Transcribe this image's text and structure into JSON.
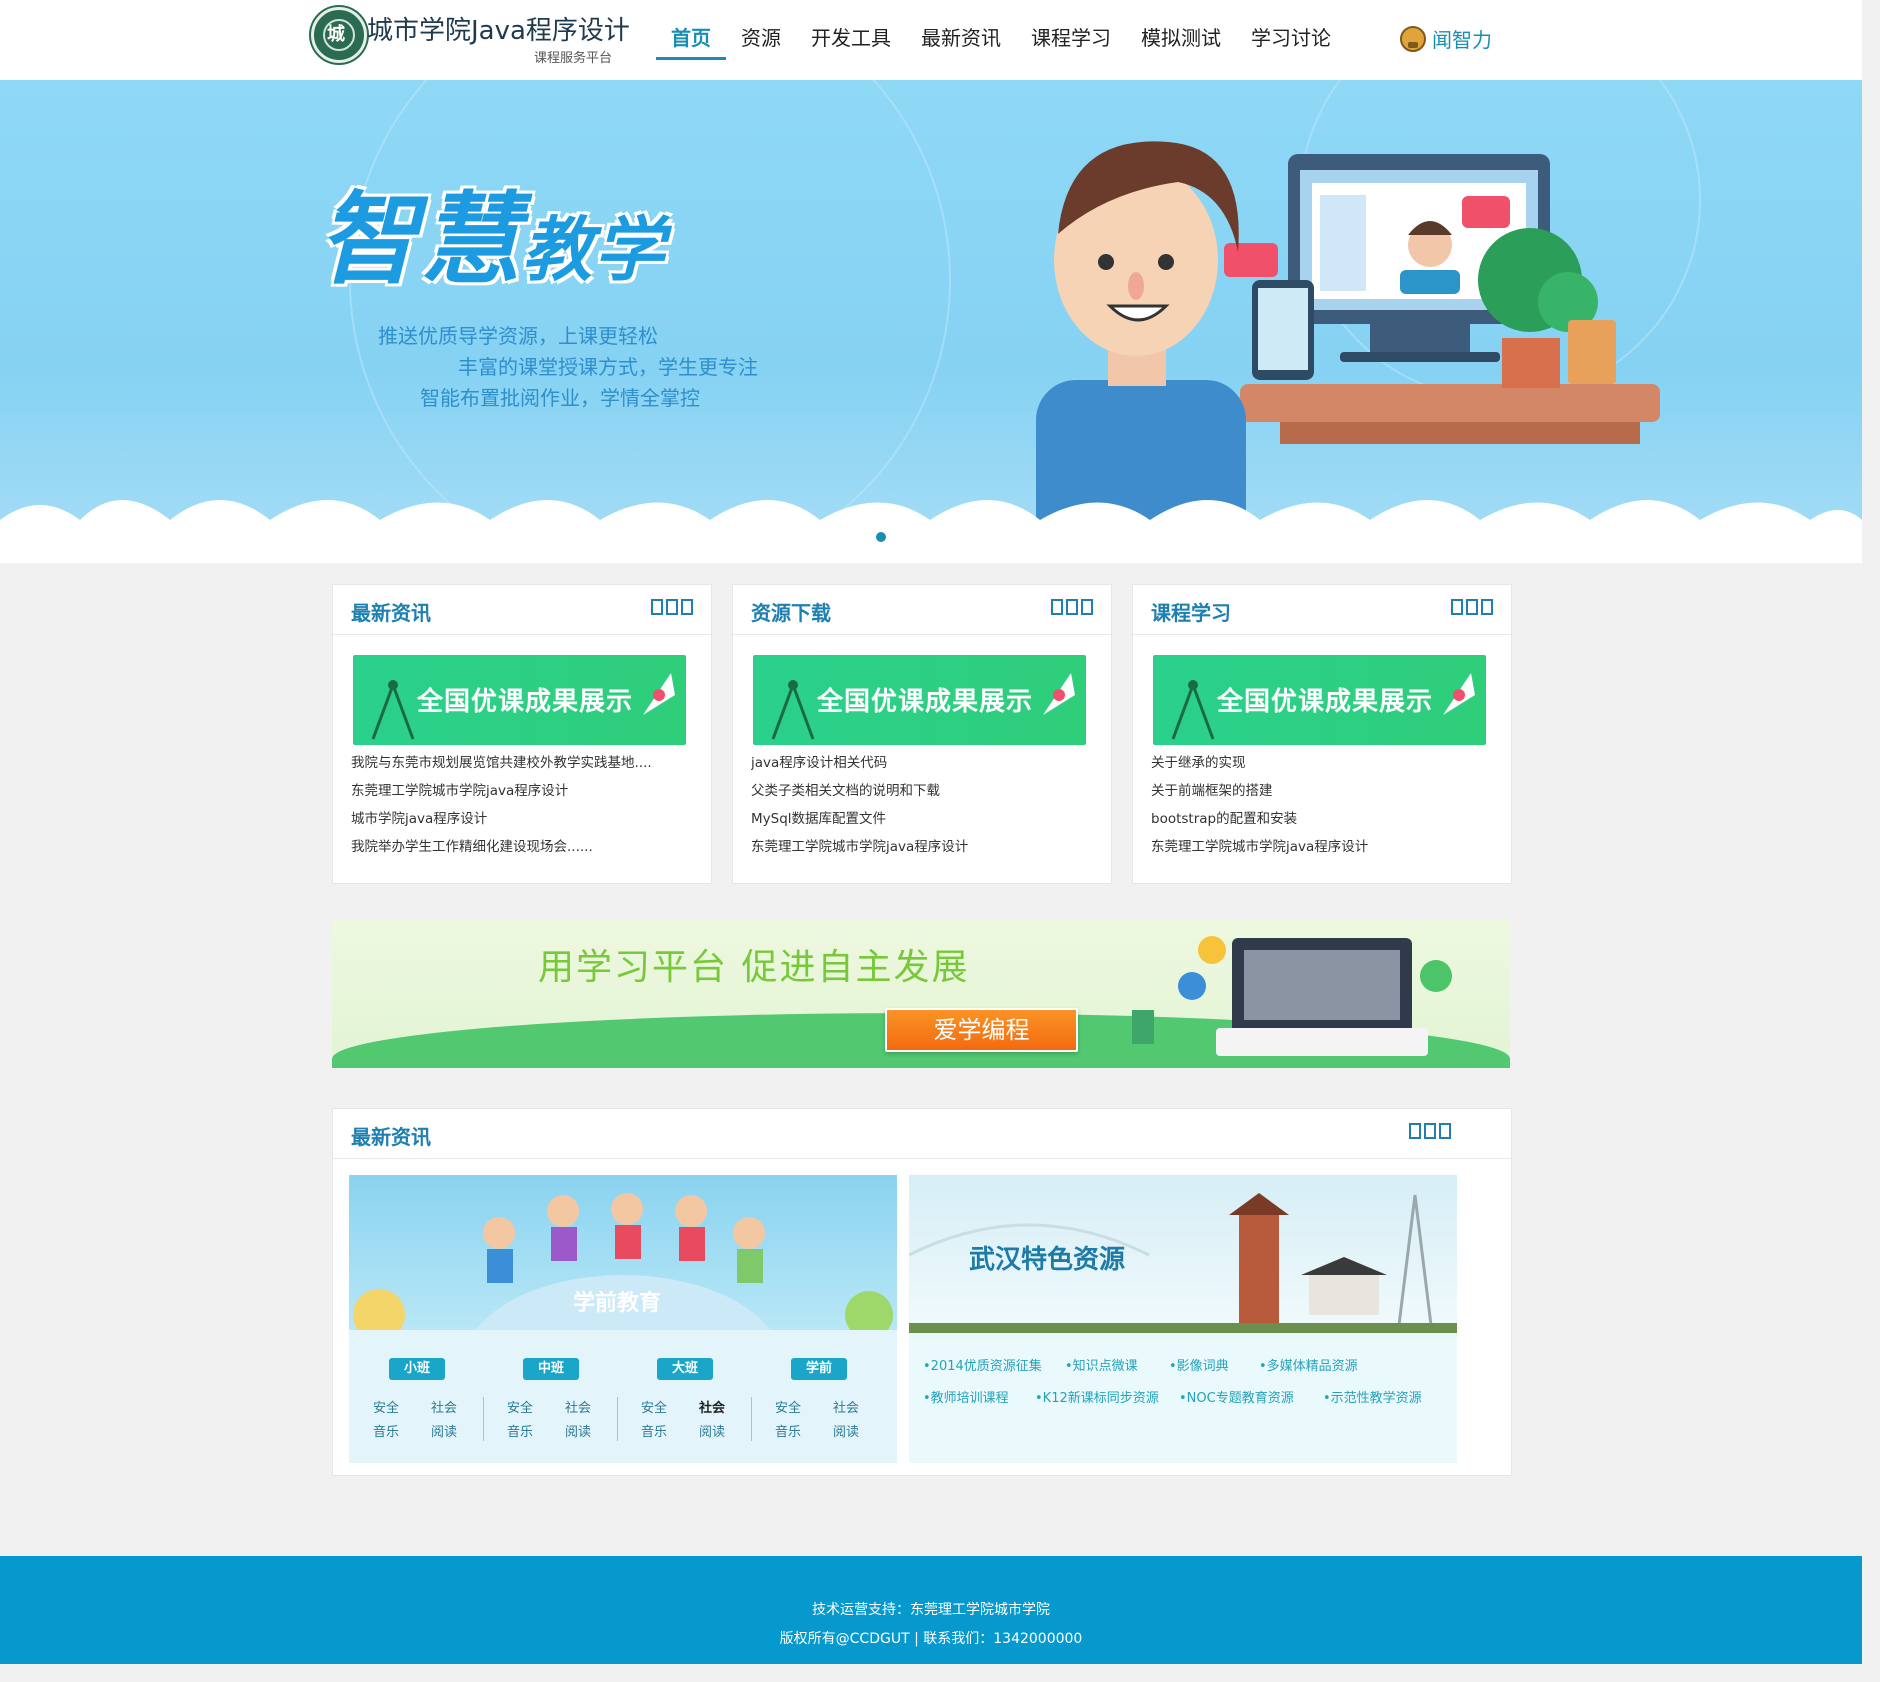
{
  "header": {
    "title": "城市学院Java程序设计",
    "subtitle": "课程服务平台",
    "logo_glyph": "城",
    "nav": [
      "首页",
      "资源",
      "开发工具",
      "最新资讯",
      "课程学习",
      "模拟测试",
      "学习讨论"
    ],
    "active_nav": "首页",
    "user_name": "闻智力"
  },
  "banner": {
    "title_main": "智慧",
    "title_small": "教学",
    "lines": [
      "推送优质导学资源，上课更轻松",
      "丰富的课堂授课方式，学生更专注",
      "智能布置批阅作业，学情全掌控"
    ],
    "slide_count": 4,
    "active_slide": 1
  },
  "cards": [
    {
      "title": "最新资讯",
      "promo": "全国优课成果展示",
      "items": [
        "我院与东莞市规划展览馆共建校外教学实践基地....",
        "东莞理工学院城市学院java程序设计",
        "城市学院java程序设计",
        "我院举办学生工作精细化建设现场会......"
      ]
    },
    {
      "title": "资源下载",
      "promo": "全国优课成果展示",
      "items": [
        "java程序设计相关代码",
        "父类子类相关文档的说明和下载",
        "MySql数据库配置文件",
        "东莞理工学院城市学院java程序设计"
      ]
    },
    {
      "title": "课程学习",
      "promo": "全国优课成果展示",
      "items": [
        "关于继承的实现",
        "关于前端框架的搭建",
        "bootstrap的配置和安装",
        "东莞理工学院城市学院java程序设计"
      ]
    }
  ],
  "mid_banner": {
    "title": "用学习平台   促进自主发展",
    "button": "爱学编程"
  },
  "news": {
    "title": "最新资讯",
    "left": {
      "title": "学前教育",
      "grades": [
        {
          "label": "小班",
          "subjects": [
            "安全",
            "社会",
            "音乐",
            "阅读"
          ]
        },
        {
          "label": "中班",
          "subjects": [
            "安全",
            "社会",
            "音乐",
            "阅读"
          ]
        },
        {
          "label": "大班",
          "subjects": [
            "安全",
            "社会",
            "音乐",
            "阅读"
          ]
        },
        {
          "label": "学前",
          "subjects": [
            "安全",
            "社会",
            "音乐",
            "阅读"
          ]
        }
      ]
    },
    "right": {
      "title": "武汉特色资源",
      "tags": [
        "2014优质资源征集",
        "知识点微课",
        "影像词典",
        "多媒体精品资源",
        "教师培训课程",
        "K12新课标同步资源",
        "NOC专题教育资源",
        "示范性教学资源"
      ]
    }
  },
  "footer": {
    "line1": "技术运营支持：东莞理工学院城市学院",
    "line2": "版权所有@CCDGUT | 联系我们：1342000000"
  },
  "colors": {
    "primary": "#1a8db3",
    "footer": "#0599cd",
    "promo": "#2ad08c",
    "accent_orange": "#f36a10"
  }
}
